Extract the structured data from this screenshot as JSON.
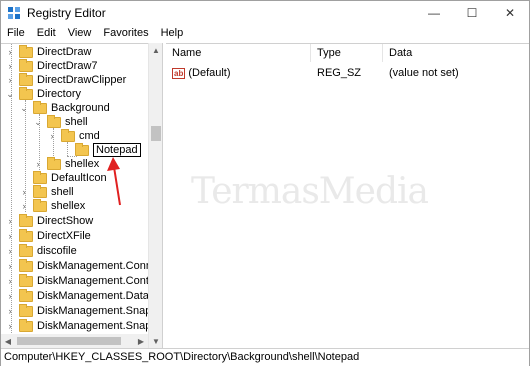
{
  "window": {
    "title": "Registry Editor"
  },
  "controls": {
    "minimize": "—",
    "maximize": "☐",
    "close": "✕"
  },
  "menu": [
    "File",
    "Edit",
    "View",
    "Favorites",
    "Help"
  ],
  "tree": {
    "items": [
      {
        "label": "DirectDraw"
      },
      {
        "label": "DirectDraw7"
      },
      {
        "label": "DirectDrawClipper"
      },
      {
        "label": "Directory"
      },
      {
        "label": "Background"
      },
      {
        "label": "shell"
      },
      {
        "label": "cmd"
      },
      {
        "label": "Notepad"
      },
      {
        "label": "shellex"
      },
      {
        "label": "DefaultIcon"
      },
      {
        "label": "shell"
      },
      {
        "label": "shellex"
      },
      {
        "label": "DirectShow"
      },
      {
        "label": "DirectXFile"
      },
      {
        "label": "discofile"
      },
      {
        "label": "DiskManagement.Connect"
      },
      {
        "label": "DiskManagement.Control"
      },
      {
        "label": "DiskManagement.DataObj"
      },
      {
        "label": "DiskManagement.SnapIn"
      },
      {
        "label": "DiskManagement.SnapInA"
      }
    ]
  },
  "list": {
    "headers": {
      "name": "Name",
      "type": "Type",
      "data": "Data"
    },
    "rows": [
      {
        "icon": "ab",
        "name": "(Default)",
        "type": "REG_SZ",
        "data": "(value not set)"
      }
    ]
  },
  "watermark": "TermasMedia",
  "status": {
    "path": "Computer\\HKEY_CLASSES_ROOT\\Directory\\Background\\shell\\Notepad"
  }
}
